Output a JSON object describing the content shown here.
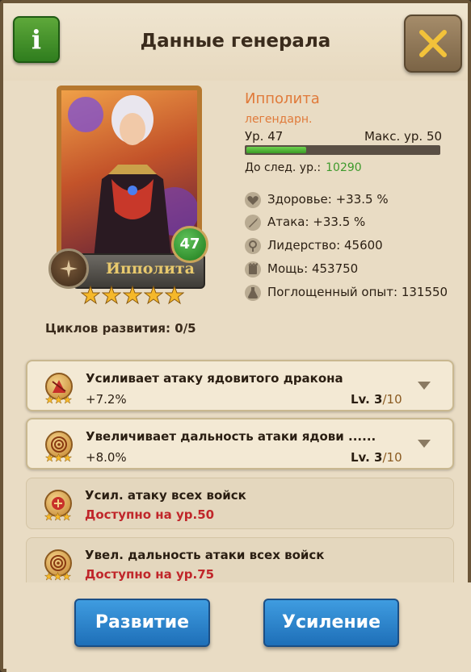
{
  "header": {
    "title": "Данные генерала",
    "info_icon": "i"
  },
  "general": {
    "name": "Ипполита",
    "rarity": "легендарн.",
    "level_label": "Ур.",
    "level": "47",
    "max_level_label": "Макс. ур.",
    "max_level": "50",
    "xp_progress": 0.31,
    "next_level_label": "До след. ур.:",
    "next_level_value": "10290",
    "badge_level": "47",
    "plate_name": "Ипполита",
    "stars": 5,
    "cycles_label": "Циклов развития:",
    "cycles_value": "0/5"
  },
  "stats": [
    {
      "icon": "heart-icon",
      "label": "Здоровье:",
      "value": "+33.5 %"
    },
    {
      "icon": "sword-icon",
      "label": "Атака:",
      "value": "+33.5 %"
    },
    {
      "icon": "leadership-icon",
      "label": "Лидерство:",
      "value": "45600"
    },
    {
      "icon": "might-icon",
      "label": "Мощь:",
      "value": "453750"
    },
    {
      "icon": "xp-flask-icon",
      "label": "Поглощенный опыт:",
      "value": "131550"
    }
  ],
  "skills": [
    {
      "title": "Усиливает атаку ядовитого дракона",
      "value": "+7.2%",
      "lv_label": "Lv. 3",
      "lv_max": "/10",
      "locked": false
    },
    {
      "title": "Увеличивает дальность атаки ядови ......",
      "value": "+8.0%",
      "lv_label": "Lv. 3",
      "lv_max": "/10",
      "locked": false
    },
    {
      "title": "Усил. атаку всех войск",
      "lock_text": "Доступно на ур.50",
      "locked": true
    },
    {
      "title": "Увел. дальность атаки всех войск",
      "lock_text": "Доступно на ур.75",
      "locked": true
    }
  ],
  "buttons": {
    "develop": "Развитие",
    "enhance": "Усиление"
  },
  "colors": {
    "accent_name": "#e07a3a",
    "xp_green": "#3d9a2c",
    "locked_red": "#c0262a",
    "button_blue": "#1e6fb8"
  }
}
